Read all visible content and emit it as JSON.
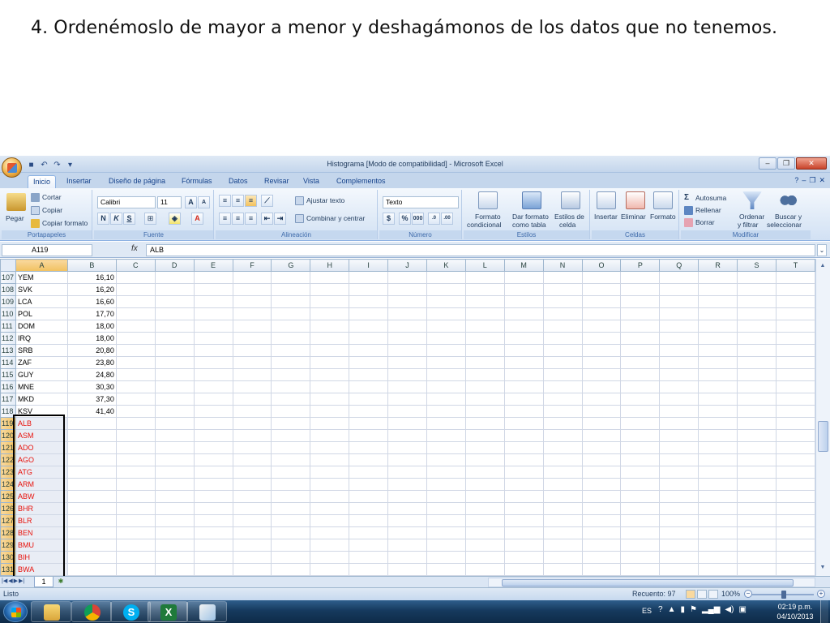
{
  "slide": {
    "title": "4. Ordenémoslo de mayor a menor y deshagámonos de los datos que no tenemos."
  },
  "window": {
    "title": "Histograma  [Modo de compatibilidad] - Microsoft Excel",
    "tabs": [
      "Inicio",
      "Insertar",
      "Diseño de página",
      "Fórmulas",
      "Datos",
      "Revisar",
      "Vista",
      "Complementos"
    ],
    "active_tab": "Inicio"
  },
  "ribbon": {
    "clipboard": {
      "paste": "Pegar",
      "cut": "Cortar",
      "copy": "Copiar",
      "format_painter": "Copiar formato",
      "label": "Portapapeles"
    },
    "font": {
      "name": "Calibri",
      "size": "11",
      "label": "Fuente"
    },
    "alignment": {
      "wrap": "Ajustar texto",
      "merge": "Combinar y centrar",
      "label": "Alineación"
    },
    "number": {
      "format": "Texto",
      "label": "Número"
    },
    "styles": {
      "conditional_1": "Formato",
      "conditional_2": "condicional",
      "table_1": "Dar formato",
      "table_2": "como tabla",
      "cell_1": "Estilos de",
      "cell_2": "celda",
      "label": "Estilos"
    },
    "cells": {
      "insert": "Insertar",
      "delete": "Eliminar",
      "format": "Formato",
      "label": "Celdas"
    },
    "editing": {
      "autosum": "Autosuma",
      "fill": "Rellenar",
      "clear": "Borrar",
      "sort_1": "Ordenar",
      "sort_2": "y filtrar",
      "find_1": "Buscar y",
      "find_2": "seleccionar",
      "label": "Modificar"
    }
  },
  "formula_bar": {
    "name_box": "A119",
    "fx": "fx",
    "value": "ALB"
  },
  "columns": [
    "A",
    "B",
    "C",
    "D",
    "E",
    "F",
    "G",
    "H",
    "I",
    "J",
    "K",
    "L",
    "M",
    "N",
    "O",
    "P",
    "Q",
    "R",
    "S",
    "T"
  ],
  "selected_column": "A",
  "rows": [
    {
      "num": "107",
      "a": "YEM",
      "b": "16,10",
      "red": false
    },
    {
      "num": "108",
      "a": "SVK",
      "b": "16,20",
      "red": false
    },
    {
      "num": "109",
      "a": "LCA",
      "b": "16,60",
      "red": false
    },
    {
      "num": "110",
      "a": "POL",
      "b": "17,70",
      "red": false
    },
    {
      "num": "111",
      "a": "DOM",
      "b": "18,00",
      "red": false
    },
    {
      "num": "112",
      "a": "IRQ",
      "b": "18,00",
      "red": false
    },
    {
      "num": "113",
      "a": "SRB",
      "b": "20,80",
      "red": false
    },
    {
      "num": "114",
      "a": "ZAF",
      "b": "23,80",
      "red": false
    },
    {
      "num": "115",
      "a": "GUY",
      "b": "24,80",
      "red": false
    },
    {
      "num": "116",
      "a": "MNE",
      "b": "30,30",
      "red": false
    },
    {
      "num": "117",
      "a": "MKD",
      "b": "37,30",
      "red": false
    },
    {
      "num": "118",
      "a": "KSV",
      "b": "41,40",
      "red": false
    },
    {
      "num": "119",
      "a": "ALB",
      "b": "",
      "red": true
    },
    {
      "num": "120",
      "a": "ASM",
      "b": "",
      "red": true
    },
    {
      "num": "121",
      "a": "ADO",
      "b": "",
      "red": true
    },
    {
      "num": "122",
      "a": "AGO",
      "b": "",
      "red": true
    },
    {
      "num": "123",
      "a": "ATG",
      "b": "",
      "red": true
    },
    {
      "num": "124",
      "a": "ARM",
      "b": "",
      "red": true
    },
    {
      "num": "125",
      "a": "ABW",
      "b": "",
      "red": true
    },
    {
      "num": "126",
      "a": "BHR",
      "b": "",
      "red": true
    },
    {
      "num": "127",
      "a": "BLR",
      "b": "",
      "red": true
    },
    {
      "num": "128",
      "a": "BEN",
      "b": "",
      "red": true
    },
    {
      "num": "129",
      "a": "BMU",
      "b": "",
      "red": true
    },
    {
      "num": "130",
      "a": "BIH",
      "b": "",
      "red": true
    },
    {
      "num": "131",
      "a": "BWA",
      "b": "",
      "red": true
    }
  ],
  "sheet_tab": "1",
  "status": {
    "mode": "Listo",
    "count": "Recuento: 97",
    "zoom": "100%"
  },
  "taskbar": {
    "apps": [
      "explorer-icon",
      "chrome-icon",
      "skype-icon",
      "excel-icon",
      "paint-icon"
    ],
    "lang": "ES",
    "time": "02:19 p.m.",
    "date": "04/10/2013"
  }
}
